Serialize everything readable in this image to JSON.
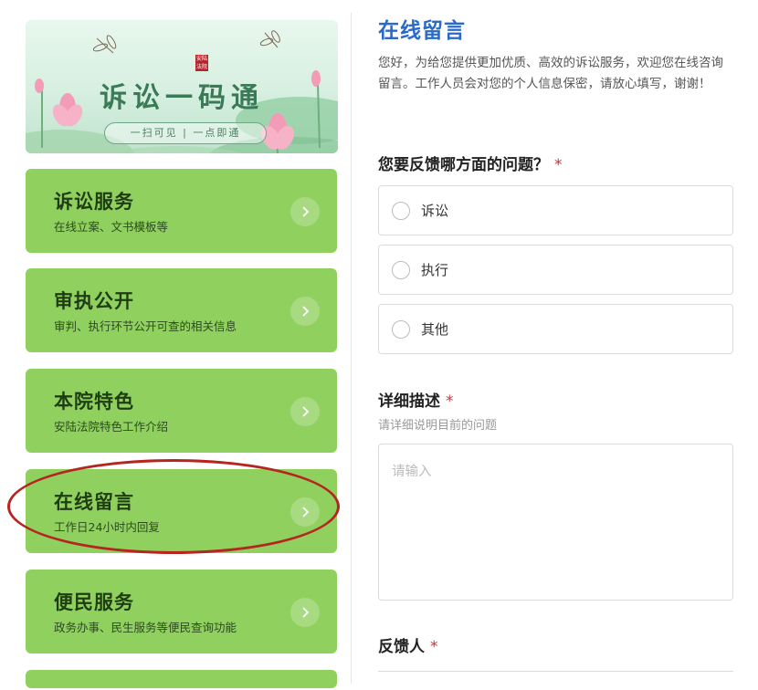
{
  "banner": {
    "title": "诉讼一码通",
    "slogan": "一扫可见 | 一点即通",
    "seal": "安陆法院"
  },
  "menu": [
    {
      "title": "诉讼服务",
      "subtitle": "在线立案、文书模板等"
    },
    {
      "title": "审执公开",
      "subtitle": "审判、执行环节公开可查的相关信息"
    },
    {
      "title": "本院特色",
      "subtitle": "安陆法院特色工作介绍"
    },
    {
      "title": "在线留言",
      "subtitle": "工作日24小时内回复"
    },
    {
      "title": "便民服务",
      "subtitle": "政务办事、民生服务等便民查询功能"
    }
  ],
  "form": {
    "title": "在线留言",
    "intro": "您好，为给您提供更加优质、高效的诉讼服务，欢迎您在线咨询留言。工作人员会对您的个人信息保密，请放心填写，谢谢！",
    "question1": {
      "label": "您要反馈哪方面的问题？",
      "required": "*",
      "options": [
        "诉讼",
        "执行",
        "其他"
      ]
    },
    "question2": {
      "label": "详细描述",
      "required": "*",
      "hint": "请详细说明目前的问题",
      "placeholder": "请输入"
    },
    "question3": {
      "label": "反馈人",
      "required": "*"
    }
  },
  "colors": {
    "card_bg": "#8fd05f",
    "title_blue": "#2a6bc9",
    "required_red": "#d0343a",
    "highlight_ring": "#b52620"
  }
}
